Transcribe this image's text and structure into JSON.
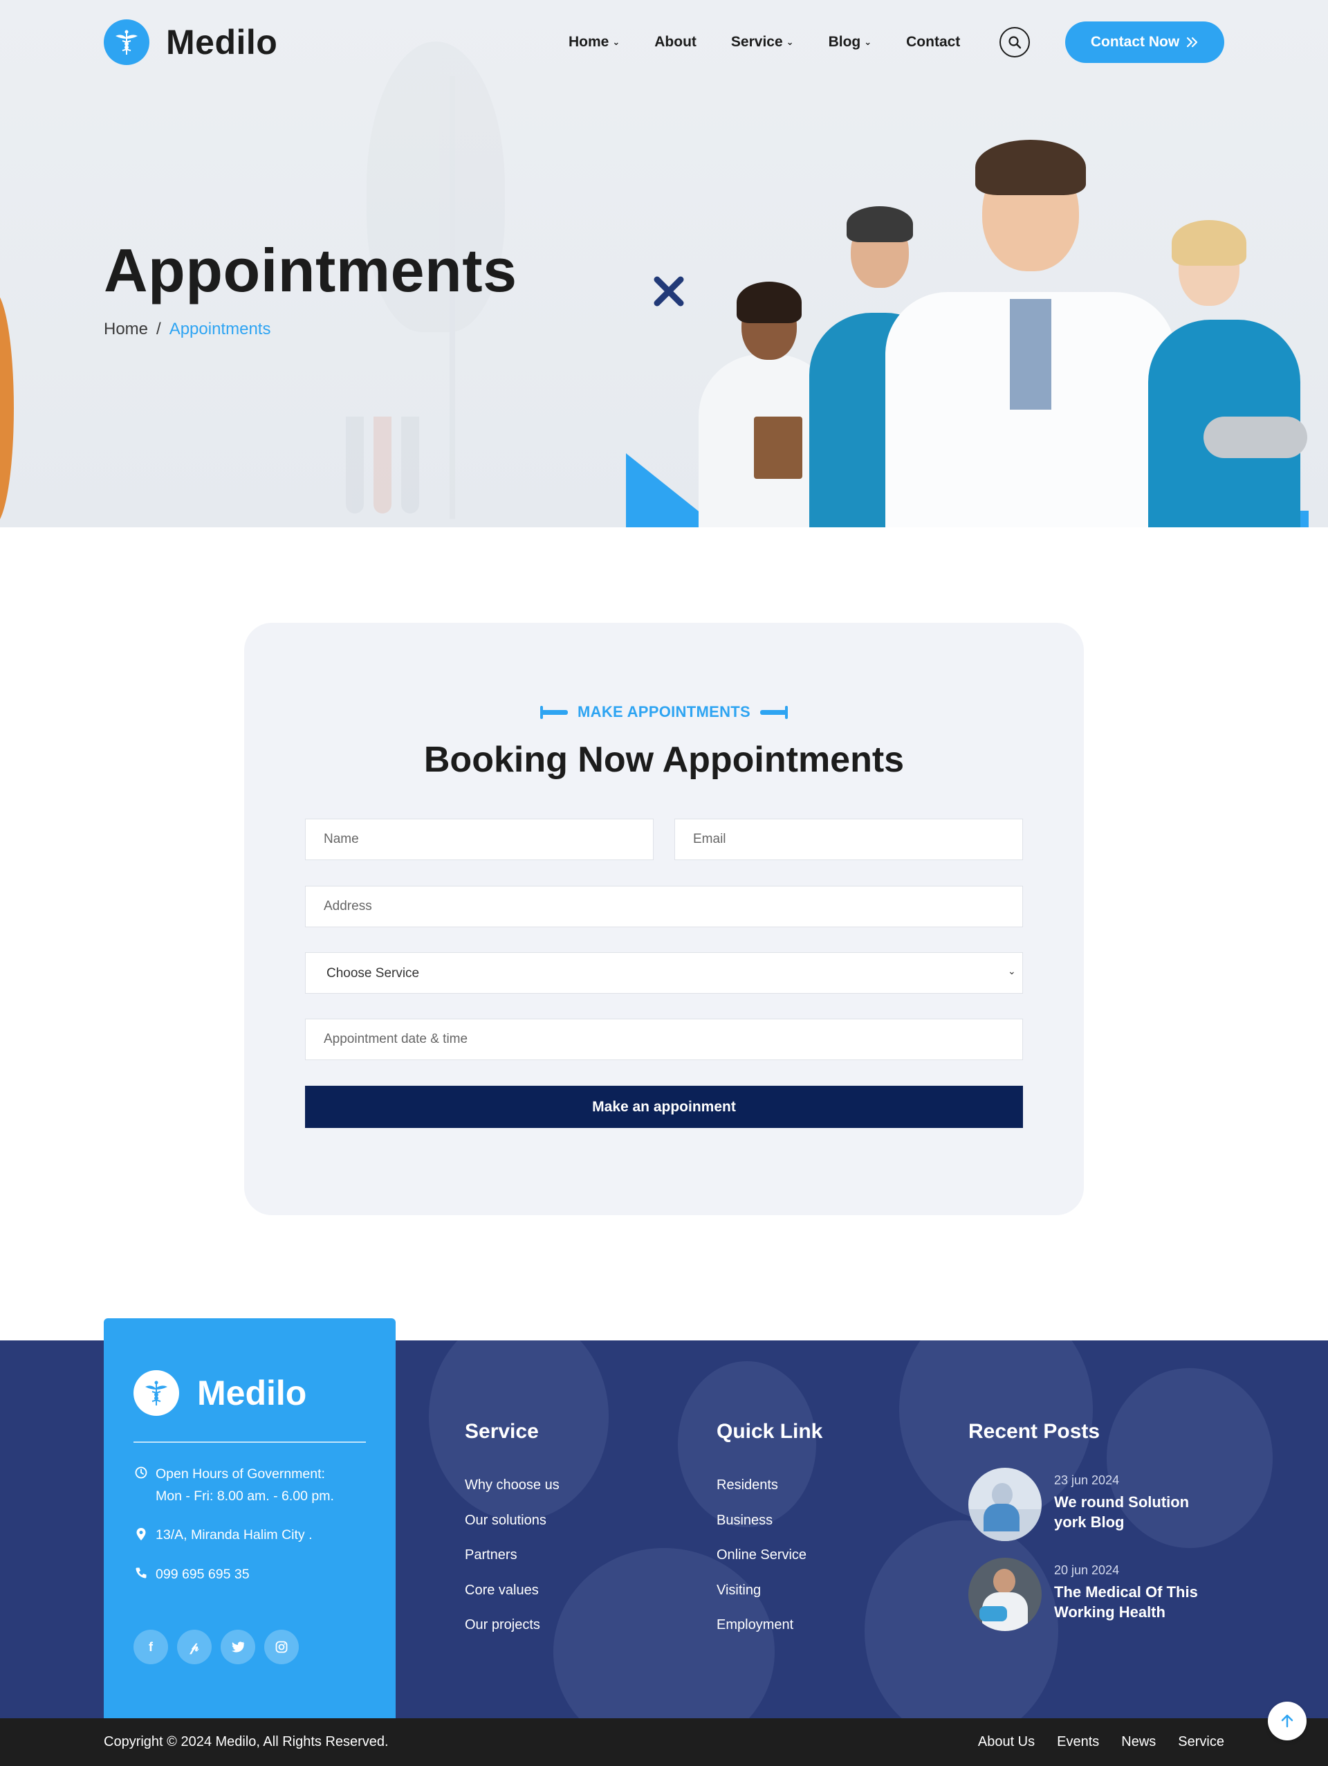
{
  "brand": {
    "name": "Medilo"
  },
  "nav": {
    "items": [
      {
        "label": "Home",
        "has_dropdown": true
      },
      {
        "label": "About",
        "has_dropdown": false
      },
      {
        "label": "Service",
        "has_dropdown": true
      },
      {
        "label": "Blog",
        "has_dropdown": true
      },
      {
        "label": "Contact",
        "has_dropdown": false
      }
    ],
    "search_icon": "search-icon",
    "cta_label": "Contact Now"
  },
  "hero": {
    "title": "Appointments",
    "breadcrumb": {
      "home": "Home",
      "separator": "/",
      "current": "Appointments"
    }
  },
  "appointment": {
    "eyebrow": "MAKE APPOINTMENTS",
    "title": "Booking Now Appointments",
    "fields": {
      "name_placeholder": "Name",
      "email_placeholder": "Email",
      "address_placeholder": "Address",
      "service_selected": "Choose Service",
      "datetime_placeholder": "Appointment date & time"
    },
    "submit_label": "Make an appoinment"
  },
  "footer": {
    "brand_name": "Medilo",
    "hours_label": "Open Hours of Government:",
    "hours_value": "Mon - Fri: 8.00 am. - 6.00 pm.",
    "address": "13/A, Miranda Halim City .",
    "phone": "099 695 695 35",
    "socials": [
      "facebook-icon",
      "pinterest-icon",
      "twitter-icon",
      "instagram-icon"
    ],
    "service": {
      "title": "Service",
      "links": [
        "Why choose us",
        "Our solutions",
        "Partners",
        "Core values",
        "Our projects"
      ]
    },
    "quick_link": {
      "title": "Quick Link",
      "links": [
        "Residents",
        "Business",
        "Online Service",
        "Visiting",
        "Employment"
      ]
    },
    "recent_posts": {
      "title": "Recent Posts",
      "posts": [
        {
          "date": "23 jun 2024",
          "title": "We round Solution york Blog"
        },
        {
          "date": "20 jun 2024",
          "title": "The Medical Of This Working Health"
        }
      ]
    },
    "copyright": "Copyright © 2024 Medilo, All Rights Reserved.",
    "bottom_links": [
      "About Us",
      "Events",
      "News",
      "Service"
    ]
  },
  "colors": {
    "accent": "#2ea4f2",
    "navy": "#0b2157",
    "footer_bg": "#2a3b78",
    "bottom_bar": "#1e1e1e"
  }
}
